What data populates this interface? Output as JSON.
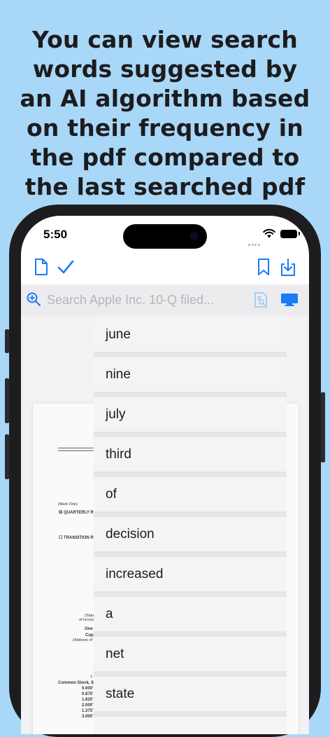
{
  "promo": {
    "lines": [
      "You can view search",
      "words suggested by",
      "an AI algorithm based",
      "on their frequency in",
      "the pdf compared to",
      "the last searched pdf"
    ]
  },
  "status_bar": {
    "time": "5:50"
  },
  "toolbar": {
    "left_icons": [
      "document-icon",
      "checkmark-icon"
    ],
    "right_icons": [
      "bookmark-icon",
      "download-icon"
    ],
    "accent_color": "#1a7bf5"
  },
  "search": {
    "placeholder": "Search Apple Inc. 10-Q filed...",
    "icons": [
      "zoom-in-icon",
      "document-search-icon",
      "desktop-icon"
    ]
  },
  "document": {
    "mark_one": "(Mark One)",
    "quarterly": "☒ QUARTERLY R",
    "transition": "☐ TRANSITION R",
    "state": "(State",
    "incorp": "of incorp",
    "one": "One",
    "cupertino": "Cup",
    "address": "(Address of",
    "t": "T",
    "common_stock": "Common Stock, $",
    "rates": [
      "0.000'",
      "0.875'",
      "1.625'",
      "2.000'",
      "1.375'",
      "3.000'"
    ]
  },
  "suggestions": [
    "june",
    "nine",
    "july",
    "third",
    "of",
    "decision",
    "increased",
    "a",
    "net",
    "state"
  ]
}
